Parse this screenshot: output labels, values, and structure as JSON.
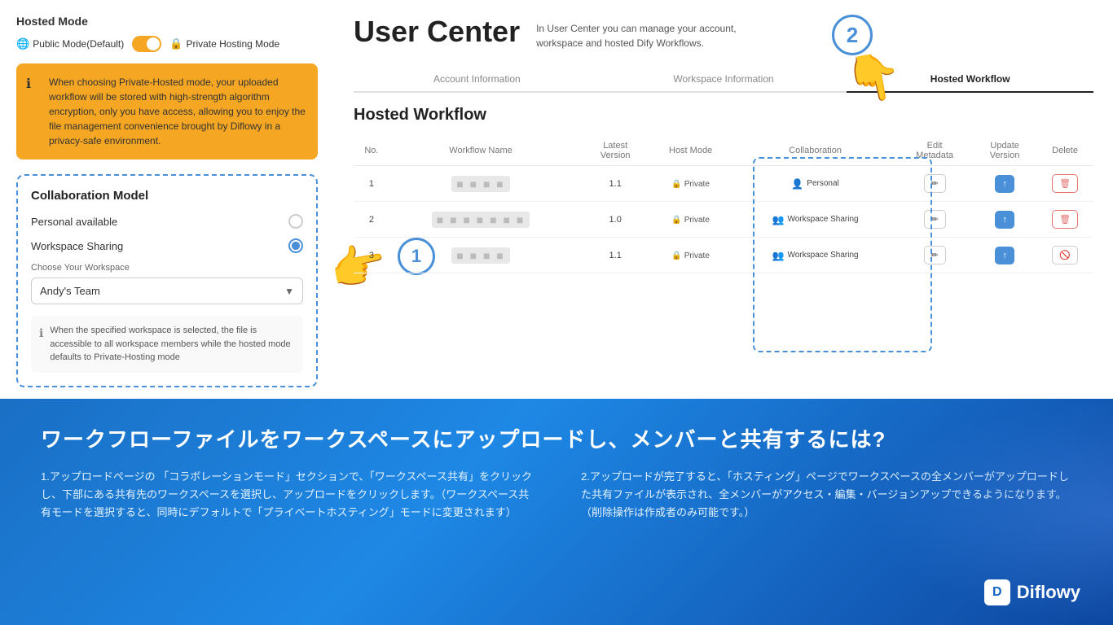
{
  "header": {
    "title": "User Center",
    "description": "In User Center you can manage your account, workspace and hosted Dify Workflows."
  },
  "left_panel": {
    "hosted_mode_title": "Hosted Mode",
    "public_mode_label": "Public Mode(Default)",
    "private_hosting_label": "Private Hosting Mode",
    "warning_text": "When choosing Private-Hosted mode, your uploaded workflow will be stored with high-strength algorithm encryption, only you have access, allowing you to enjoy the file management convenience brought by Diflowy in a privacy-safe environment.",
    "collab_title": "Collaboration Model",
    "personal_label": "Personal available",
    "workspace_label": "Workspace Sharing",
    "choose_workspace_label": "Choose Your Workspace",
    "workspace_value": "Andy's Team",
    "note_text": "When the specified workspace is selected, the file is accessible to all workspace members while the hosted mode defaults to Private-Hosting mode"
  },
  "tabs": {
    "items": [
      {
        "label": "Account Information",
        "active": false
      },
      {
        "label": "Workspace Information",
        "active": false
      },
      {
        "label": "Hosted Workflow",
        "active": true
      }
    ]
  },
  "hosted_workflow": {
    "title": "Hosted Workflow",
    "table": {
      "headers": [
        "No.",
        "Workflow Name",
        "",
        "Latest Version",
        "Host Mode",
        "Collaboration",
        "Edit Metadata",
        "Update Version",
        "Delete"
      ],
      "rows": [
        {
          "no": "1",
          "name": "■■■■■",
          "version": "1.1",
          "host_mode": "Private",
          "collab": "Personal",
          "collab_type": "personal"
        },
        {
          "no": "2",
          "name": "■■■■■■■■■■■■",
          "version": "1.0",
          "host_mode": "Private",
          "collab": "Workspace Sharing",
          "collab_type": "workspace"
        },
        {
          "no": "3",
          "name": "■■■■■",
          "version": "1.1",
          "host_mode": "Private",
          "collab": "Workspace Sharing",
          "collab_type": "workspace"
        }
      ]
    }
  },
  "circle_numbers": {
    "one": "①",
    "two": "②"
  },
  "bottom": {
    "title": "ワークフローファイルをワークスペースにアップロードし、メンバーと共有するには?",
    "col1": "1.アップロードページの 「コラボレーションモード」セクションで、「ワークスペース共有」をクリックし、下部にある共有先のワークスペースを選択し、アップロードをクリックします。（ワークスペース共有モードを選択すると、同時にデフォルトで「プライベートホスティング」モードに変更されます）",
    "col2": "2.アップロードが完了すると、「ホスティング」ページでワークスペースの全メンバーがアップロードした共有ファイルが表示され、全メンバーがアクセス・編集・バージョンアップできるようになります。　（削除操作は作成者のみ可能です。）",
    "logo_text": "Diflowy"
  }
}
